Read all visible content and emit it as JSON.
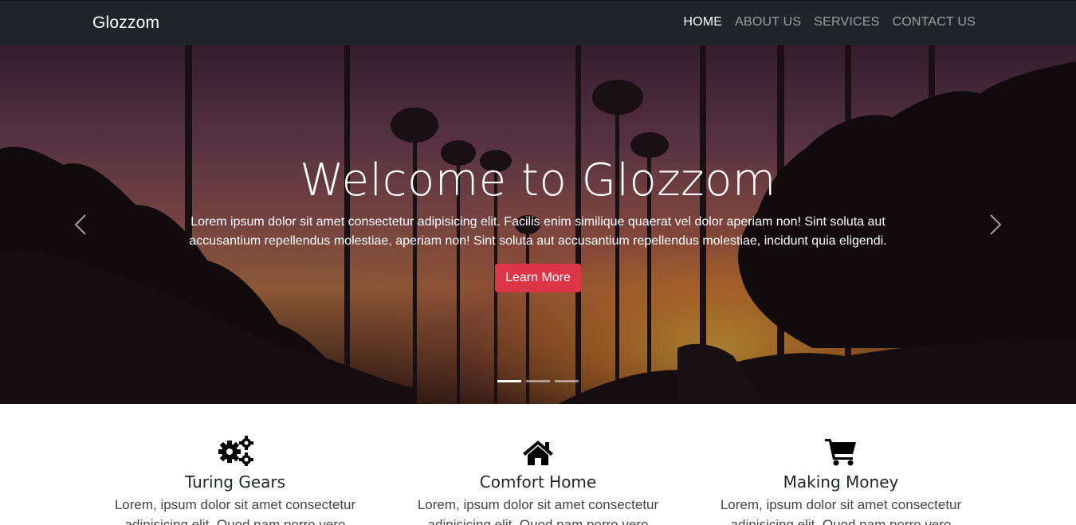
{
  "navbar": {
    "brand": "Glozzom",
    "links": [
      {
        "label": "HOME",
        "active": true
      },
      {
        "label": "ABOUT US",
        "active": false
      },
      {
        "label": "SERVICES",
        "active": false
      },
      {
        "label": "CONTACT US",
        "active": false
      }
    ]
  },
  "hero": {
    "title": "Welcome to Glozzom",
    "text": "Lorem ipsum dolor sit amet consectetur adipisicing elit. Facilis enim similique quaerat vel dolor aperiam non! Sint soluta aut accusantium repellendus molestiae, aperiam non! Sint soluta aut accusantium repellendus molestiae, incidunt quia eligendi.",
    "button_label": "Learn More",
    "prev_icon": "chevron-left-icon",
    "next_icon": "chevron-right-icon",
    "slide_count": 3,
    "active_slide": 1
  },
  "features": [
    {
      "icon": "gears-icon",
      "title": "Turing Gears",
      "text": "Lorem, ipsum dolor sit amet consectetur adipisicing elit. Quod nam porro vero"
    },
    {
      "icon": "home-icon",
      "title": "Comfort Home",
      "text": "Lorem, ipsum dolor sit amet consectetur adipisicing elit. Quod nam porro vero"
    },
    {
      "icon": "shopping-cart-icon",
      "title": "Making Money",
      "text": "Lorem, ipsum dolor sit amet consectetur adipisicing elit. Quod nam porro vero"
    }
  ],
  "colors": {
    "navbar_bg": "#212529",
    "accent_button": "#dc3545",
    "text_dark": "#212529"
  }
}
